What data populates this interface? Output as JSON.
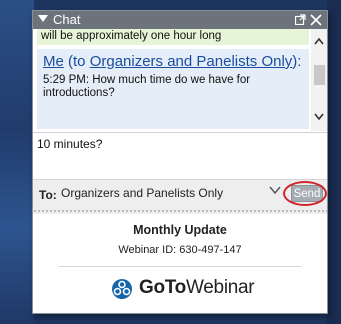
{
  "colors": {
    "titlebar": "#6d737b",
    "link": "#1a4d9e",
    "previous_message_bg": "#e6f4d8",
    "message_bg": "#e5eef8",
    "send_button": "#a5acb4",
    "highlight_ring": "#d0242a"
  },
  "chat": {
    "title": "Chat",
    "icons": {
      "collapse": "triangle-down-icon",
      "popout": "popout-icon",
      "close": "close-icon"
    },
    "previous_message_tail": "will be approximately one hour long",
    "message": {
      "sender": "Me",
      "to_prefix": " (to ",
      "recipient": "Organizers and Panelists Only",
      "to_suffix": "):",
      "text": "5:29 PM: How much time do we have for introductions?"
    },
    "compose_value": "10 minutes?",
    "to_label": "To:",
    "to_value": "Organizers and Panelists Only",
    "send_label": "Send"
  },
  "webinar": {
    "title": "Monthly Update",
    "webinar_id": "Webinar ID: 630-497-147",
    "brand_prefix": "GoTo",
    "brand_suffix": "Webinar"
  }
}
